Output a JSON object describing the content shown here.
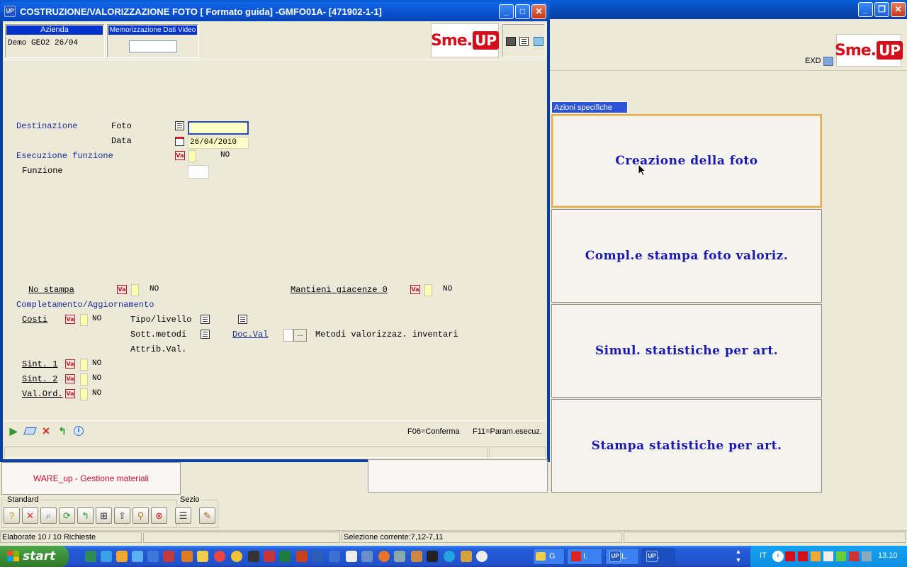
{
  "background_window": {
    "title": "",
    "user_label": "EXD",
    "section_label": "Azioni specifiche",
    "actions": [
      "Creazione della foto",
      "Compl.e stampa foto valoriz.",
      "Simul. statistiche per art.",
      "Stampa statistiche per art."
    ]
  },
  "logo": {
    "text_a": "Sme.",
    "text_b": "UP"
  },
  "dialog": {
    "title": "COSTRUZIONE/VALORIZZAZIONE FOTO [ Formato guida] -GMFO01A- [471902-1-1]",
    "header": {
      "azienda_label": "Azienda",
      "azienda_value": "Demo GEO2 26/04",
      "memorizzazione_label": "Memorizzazione Dati Video"
    },
    "form": {
      "destinazione": "Destinazione",
      "foto": "Foto",
      "data": "Data",
      "data_value": "26/04/2010",
      "esecuzione": "Esecuzione funzione",
      "esecuzione_value": "NO",
      "funzione": "Funzione",
      "no_stampa": "No stampa",
      "no_stampa_value": "NO",
      "mantieni": "Mantieni giacenze 0",
      "mantieni_value": "NO",
      "completamento": "Completamento/Aggiornamento",
      "costi": "Costi",
      "costi_value": "NO",
      "tipo_livello": "Tipo/livello",
      "sott_metodi": "Sott.metodi",
      "doc_val": "Doc.Val",
      "doc_val_button": "...",
      "metodi_desc": "Metodi valorizzaz. inventari",
      "attrib_val": "Attrib.Val.",
      "sint1": "Sint. 1",
      "sint1_value": "NO",
      "sint2": "Sint. 2",
      "sint2_value": "NO",
      "val_ord": "Val.Ord.",
      "val_ord_value": "NO"
    },
    "fkeys": {
      "f06": "F06=Conferma",
      "f11": "F11=Param.esecuz."
    }
  },
  "ware_button": "WARE_up - Gestione materiali",
  "toolbar": {
    "standard_label": "Standard",
    "sezio_label": "Sezio"
  },
  "status": {
    "elaborate": "Elaborate 10 / 10 Richieste",
    "selezione": "Selezione corrente:7,12-7,11"
  },
  "taskbar": {
    "start": "start",
    "tasks": [
      "G",
      "I.",
      "L.",
      "."
    ],
    "language": "IT",
    "clock": "13.10"
  },
  "colors": {
    "accent_blue": "#0033cc",
    "action_text": "#1a1ab0",
    "brand_red": "#d40f1c"
  }
}
